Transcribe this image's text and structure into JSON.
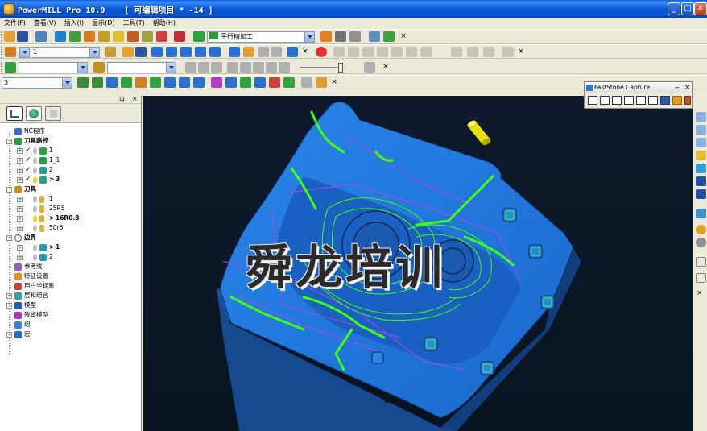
{
  "window": {
    "title": "PowerMILL Pro 10.0    [ 可编辑项目 * -14 ]",
    "minimize_label": "_",
    "maximize_label": "□",
    "close_label": "✕"
  },
  "menu": [
    "文件(F)",
    "查看(V)",
    "插入(I)",
    "显示(D)",
    "工具(T)",
    "帮助(H)"
  ],
  "toolbar1": {
    "strategy_combo": "平行精加工",
    "close": "×"
  },
  "toolbar2": {
    "combo_value": "1",
    "close1": "×",
    "close2": "×"
  },
  "toolbar3": {
    "close": "×"
  },
  "toolbar4": {
    "combo_value": "3",
    "close": "×"
  },
  "explorer": {
    "pin": "⊡",
    "close": "×",
    "tree": {
      "nc_programs": "NC程序",
      "toolpaths": "刀具路径",
      "tp_items": [
        "1",
        "1_1",
        "2",
        "3"
      ],
      "tools": "刀具",
      "tool_items": [
        "1",
        "25R5",
        "16R0.8",
        "50r6"
      ],
      "boundaries": "边界",
      "boundary_items": [
        "1",
        "2"
      ],
      "reference_lines": "参考线",
      "feature_sets": "特征设置",
      "user_csys": "用户坐标系",
      "levels": "层和组合",
      "models": "模型",
      "stock_models": "残留模型",
      "groups": "组",
      "macros": "宏"
    }
  },
  "viewport": {
    "watermark": "舜龙培训"
  },
  "faststone": {
    "title": "FastStone Capture",
    "minimize": "‒",
    "close": "×"
  },
  "right_toolbar": {
    "close": "×"
  },
  "colors": {
    "model_blue": "#1c6fd4",
    "toolpath_green": "#3cff14",
    "boundary_magenta": "#c040ff",
    "titlebar": "#0a58d8"
  }
}
